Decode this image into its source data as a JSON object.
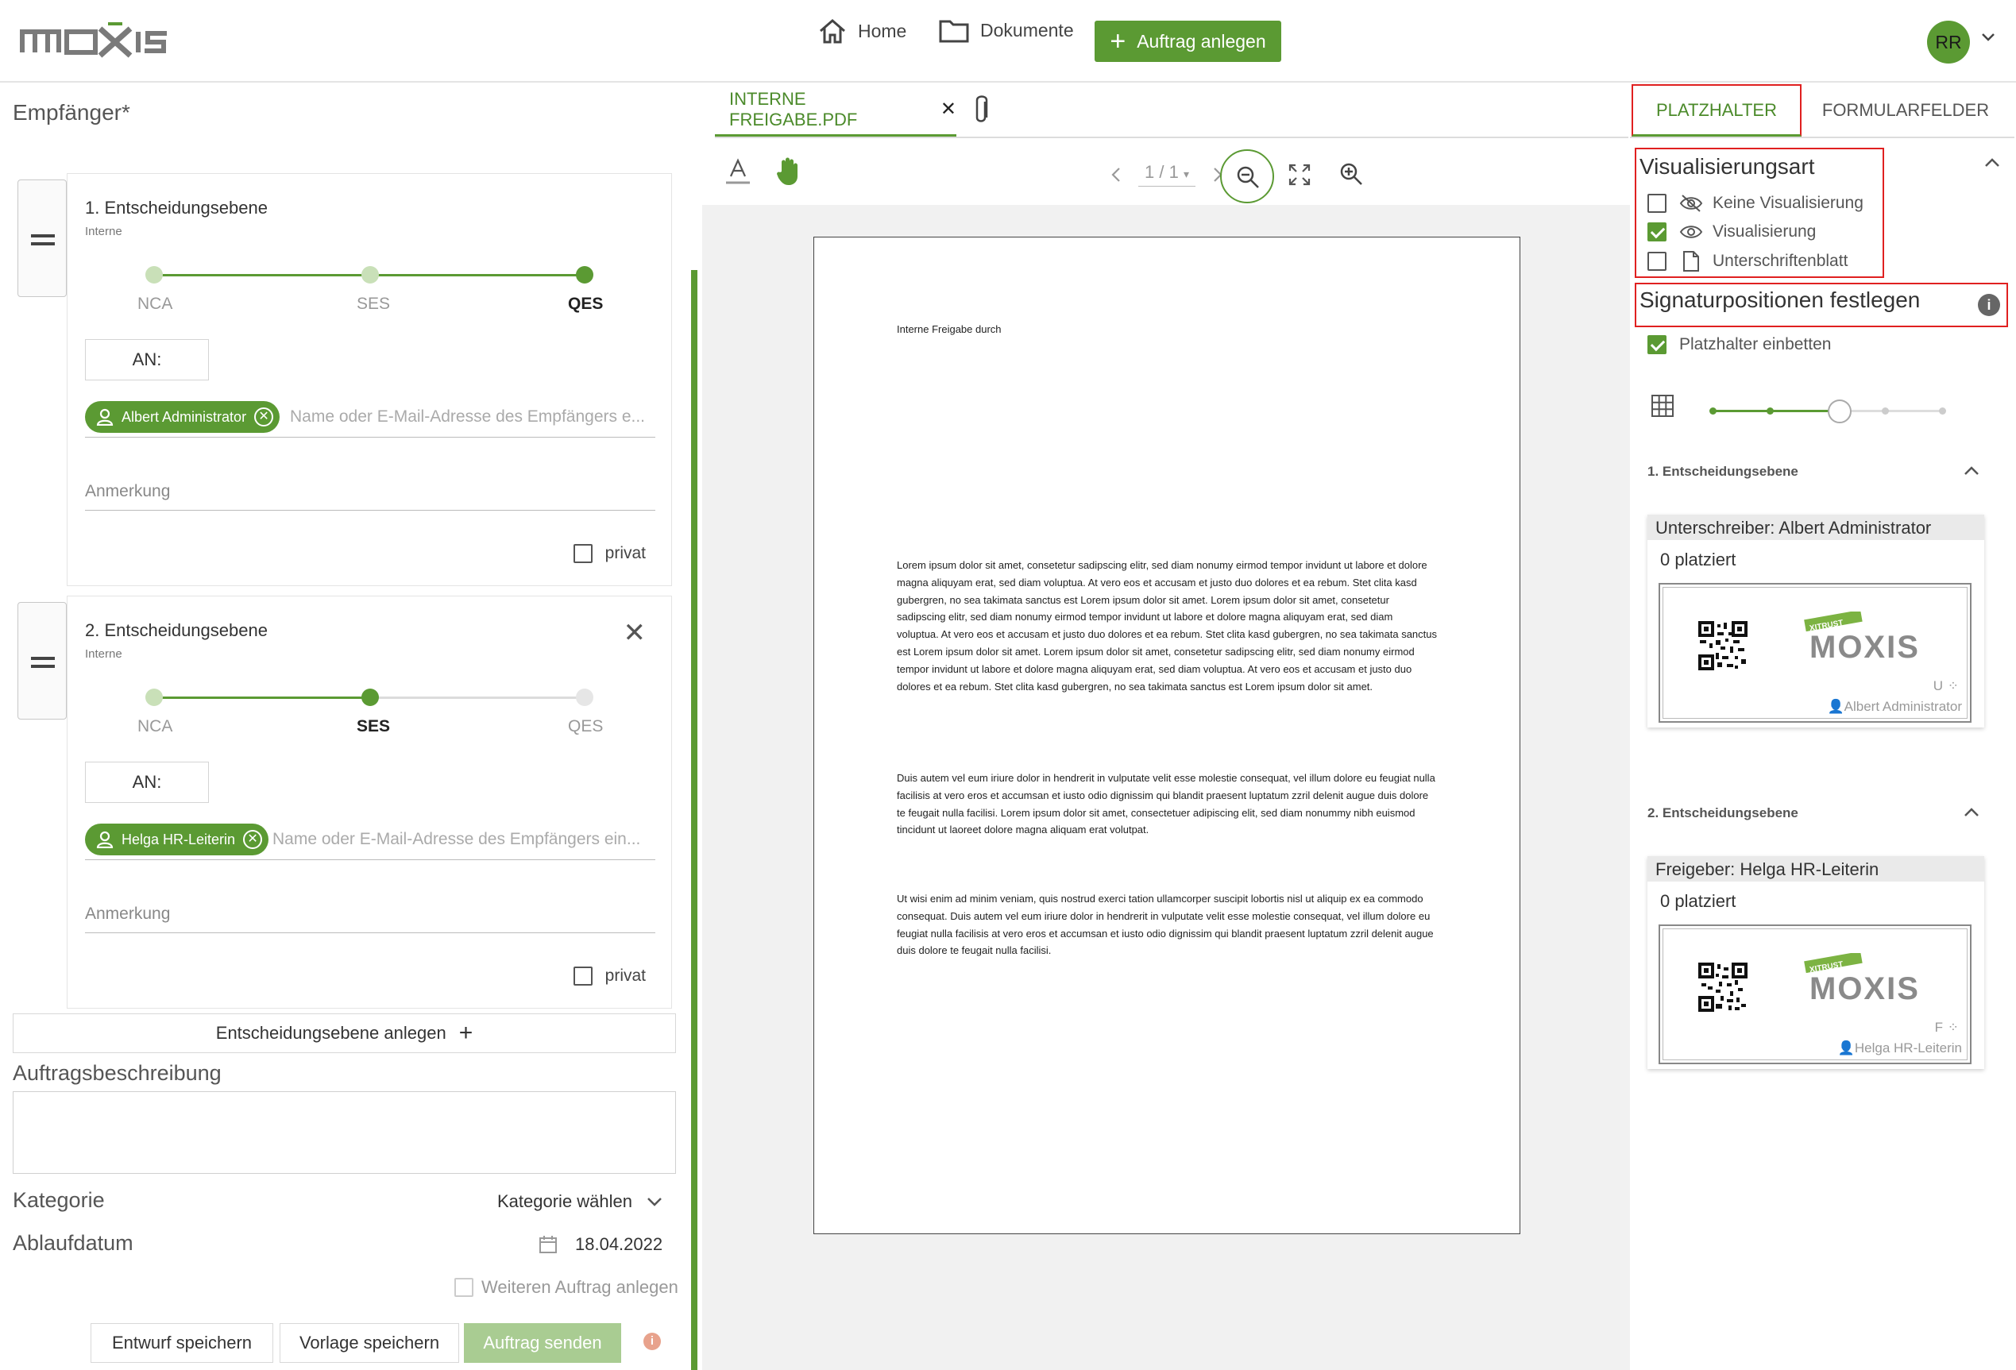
{
  "header": {
    "nav_home": "Home",
    "nav_documents": "Dokumente",
    "create_order": "Auftrag anlegen",
    "user_initials": "RR"
  },
  "left": {
    "recipients_label": "Empfänger*",
    "levels": [
      {
        "title": "1. Entscheidungsebene",
        "subtitle": "Interne",
        "options": [
          "NCA",
          "SES",
          "QES"
        ],
        "selected": "QES",
        "an_label": "AN:",
        "recipient": "Albert Administrator",
        "recipient_placeholder": "Name oder E-Mail-Adresse des Empfängers e...",
        "note_label": "Anmerkung",
        "private_label": "privat"
      },
      {
        "title": "2. Entscheidungsebene",
        "subtitle": "Interne",
        "options": [
          "NCA",
          "SES",
          "QES"
        ],
        "selected": "SES",
        "an_label": "AN:",
        "recipient": "Helga HR-Leiterin",
        "recipient_placeholder": "Name oder E-Mail-Adresse des Empfängers ein...",
        "note_label": "Anmerkung",
        "private_label": "privat"
      }
    ],
    "add_level": "Entscheidungsebene anlegen",
    "description_label": "Auftragsbeschreibung",
    "category_label": "Kategorie",
    "category_value": "Kategorie wählen",
    "expiry_label": "Ablaufdatum",
    "expiry_value": "18.04.2022",
    "another_order": "Weiteren Auftrag anlegen",
    "save_draft": "Entwurf speichern",
    "save_template": "Vorlage speichern",
    "send_order": "Auftrag senden"
  },
  "viewer": {
    "tab_file": "INTERNE FREIGABE.PDF",
    "page_indicator": "1 / 1",
    "doc_heading": "Interne Freigabe durch",
    "paragraphs": [
      "Lorem ipsum dolor sit amet, consetetur sadipscing elitr, sed diam nonumy eirmod tempor invidunt ut labore et dolore magna aliquyam erat, sed diam voluptua. At vero eos et accusam et justo duo dolores et ea rebum. Stet clita kasd gubergren, no sea takimata sanctus est Lorem ipsum dolor sit amet. Lorem ipsum dolor sit amet, consetetur sadipscing elitr, sed diam nonumy eirmod tempor invidunt ut labore et dolore magna aliquyam erat, sed diam voluptua. At vero eos et accusam et justo duo dolores et ea rebum. Stet clita kasd gubergren, no sea takimata sanctus est Lorem ipsum dolor sit amet. Lorem ipsum dolor sit amet, consetetur sadipscing elitr, sed diam nonumy eirmod tempor invidunt ut labore et dolore magna aliquyam erat, sed diam voluptua. At vero eos et accusam et justo duo dolores et ea rebum. Stet clita kasd gubergren, no sea takimata sanctus est Lorem ipsum dolor sit amet.",
      "Duis autem vel eum iriure dolor in hendrerit in vulputate velit esse molestie consequat, vel illum dolore eu feugiat nulla facilisis at vero eros et accumsan et iusto odio dignissim qui blandit praesent luptatum zzril delenit augue duis dolore te feugait nulla facilisi. Lorem ipsum dolor sit amet, consectetuer adipiscing elit, sed diam nonummy nibh euismod tincidunt ut laoreet dolore magna aliquam erat volutpat.",
      "Ut wisi enim ad minim veniam, quis nostrud exerci tation ullamcorper suscipit lobortis nisl ut aliquip ex ea commodo consequat. Duis autem vel eum iriure dolor in hendrerit in vulputate velit esse molestie consequat, vel illum dolore eu feugiat nulla facilisis at vero eros et accumsan et iusto odio dignissim qui blandit praesent luptatum zzril delenit augue duis dolore te feugait nulla facilisi."
    ]
  },
  "right": {
    "tab_placeholders": "PLATZHALTER",
    "tab_formfields": "FORMULARFELDER",
    "visualization_title": "Visualisierungsart",
    "vis_none": "Keine Visualisierung",
    "vis_on": "Visualisierung",
    "vis_sheet": "Unterschriftenblatt",
    "signature_title": "Signaturpositionen festlegen",
    "embed_placeholder": "Platzhalter einbetten",
    "size_level": 0.55,
    "sections": [
      {
        "title": "1. Entscheidungsebene",
        "card_header": "Unterschreiber: Albert Administrator",
        "placed": "0 platziert",
        "brand_badge": "XITRUST",
        "brand_name": "MOXIS",
        "letter": "U",
        "signer": "Albert Administrator"
      },
      {
        "title": "2. Entscheidungsebene",
        "card_header": "Freigeber: Helga HR-Leiterin",
        "placed": "0 platziert",
        "brand_badge": "XITRUST",
        "brand_name": "MOXIS",
        "letter": "F",
        "signer": "Helga HR-Leiterin"
      }
    ]
  }
}
